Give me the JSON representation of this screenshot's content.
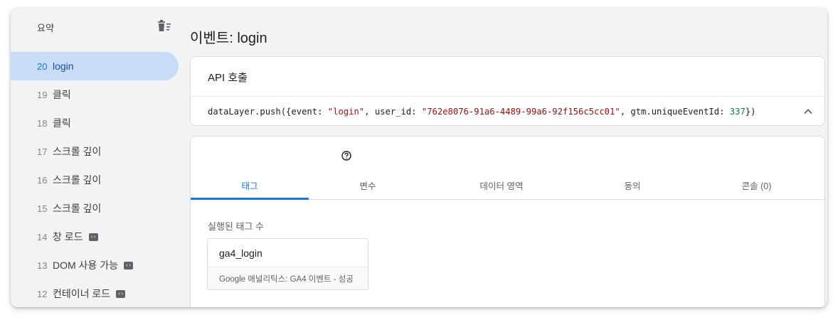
{
  "sidebar": {
    "header": "요약",
    "items": [
      {
        "num": "20",
        "label": "login"
      },
      {
        "num": "19",
        "label": "클릭"
      },
      {
        "num": "18",
        "label": "클릭"
      },
      {
        "num": "17",
        "label": "스크롤 깊이"
      },
      {
        "num": "16",
        "label": "스크롤 깊이"
      },
      {
        "num": "15",
        "label": "스크롤 깊이"
      },
      {
        "num": "14",
        "label": "창 로드"
      },
      {
        "num": "13",
        "label": "DOM 사용 가능"
      },
      {
        "num": "12",
        "label": "컨테이너 로드"
      }
    ]
  },
  "main": {
    "title": "이벤트: login",
    "api_card": {
      "title": "API 호출",
      "code": {
        "prefix": "dataLayer.push({event: ",
        "event_value": "\"login\"",
        "user_key": ", user_id: ",
        "user_value": "\"762e8076-91a6-4489-99a6-92f156c5cc01\"",
        "gtm_key": ", gtm.uniqueEventId: ",
        "gtm_value": "337",
        "suffix": "})"
      }
    },
    "tabs": [
      "태그",
      "변수",
      "데이터 영역",
      "동의",
      "콘솔 (0)"
    ],
    "fired_label": "실행된 태그 수",
    "tag": {
      "name": "ga4_login",
      "type": "Google 애널리틱스: GA4 이벤트 - 성공"
    }
  },
  "colors": {
    "accent": "#1a73e8",
    "active_bg": "#c9dcf7",
    "string": "#a50e0e",
    "number": "#0b8043"
  },
  "icons": [
    "trash-icon",
    "code-badge-icon",
    "chevron-up-icon",
    "help-icon"
  ]
}
